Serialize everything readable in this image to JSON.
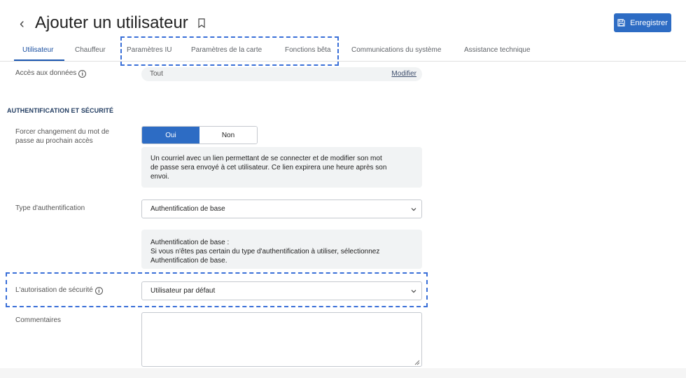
{
  "header": {
    "title": "Ajouter un utilisateur",
    "back_glyph": "‹",
    "save_label": "Enregistrer",
    "save_color": "#2d6cc4"
  },
  "tabs": [
    {
      "label": "Utilisateur",
      "active": true
    },
    {
      "label": "Chauffeur",
      "active": false
    },
    {
      "label": "Paramètres IU",
      "active": false
    },
    {
      "label": "Paramètres de la carte",
      "active": false
    },
    {
      "label": "Fonctions bêta",
      "active": false
    },
    {
      "label": "Communications du système",
      "active": false
    },
    {
      "label": "Assistance technique",
      "active": false
    }
  ],
  "form": {
    "data_access": {
      "label": "Accès aux données",
      "value": "Tout",
      "modify_label": "Modifier"
    },
    "section_title": "AUTHENTIFICATION ET SÉCURITÉ",
    "force_password": {
      "label_line1": "Forcer changement du mot de",
      "label_line2": "passe au prochain accès",
      "option_yes": "Oui",
      "option_no": "Non",
      "selected": "Oui",
      "info_line1": "Un courriel avec un lien permettant de se connecter et de modifier son mot",
      "info_line2": "de passe sera envoyé à cet utilisateur. Ce lien expirera une heure après son",
      "info_line3": "envoi."
    },
    "auth_type": {
      "label": "Type d'authentification",
      "value": "Authentification de base",
      "info_line1": "Authentification de base :",
      "info_line2": "Si vous n'êtes pas certain du type d'authentification à utiliser, sélectionnez",
      "info_line3": "Authentification de base."
    },
    "security_clearance": {
      "label": "L'autorisation de sécurité",
      "value": "Utilisateur par défaut"
    },
    "comments": {
      "label": "Commentaires",
      "value": ""
    }
  },
  "icons": {
    "back": "chevron-left-icon",
    "bookmark": "bookmark-icon",
    "save": "floppy-disk-icon",
    "info": "info-circle-icon",
    "dropdown": "chevron-down-icon"
  },
  "colors": {
    "accent": "#2d6cc4",
    "active_tab": "#1a56b0",
    "highlight_dash": "#3a6fd8"
  }
}
